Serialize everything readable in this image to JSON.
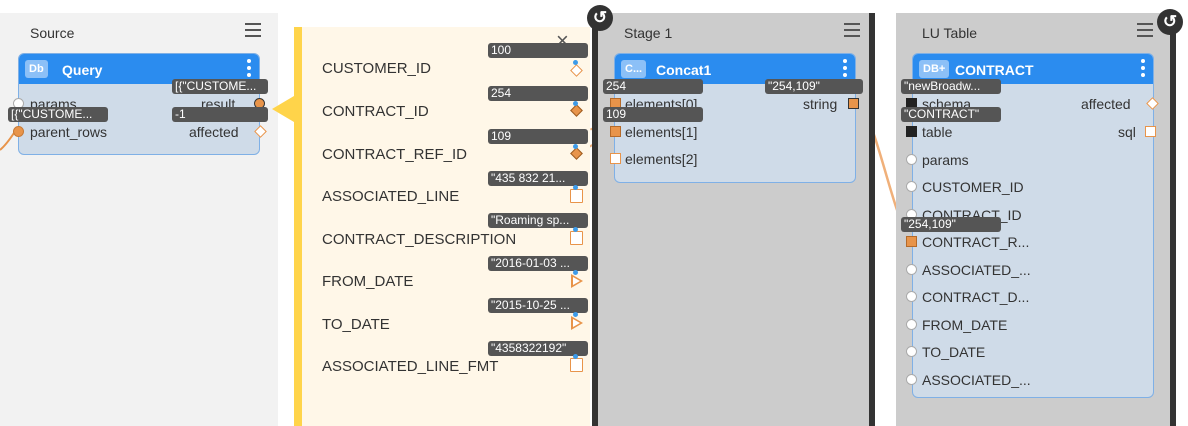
{
  "source": {
    "title": "Source",
    "node": {
      "badge": "Db",
      "label": "Query",
      "ports": {
        "params": "params",
        "result": "result",
        "parent_rows": "parent_rows",
        "affected": "affected"
      },
      "tags": {
        "result": "[{\"CUSTOME...",
        "parent_rows": "[{\"CUSTOME...",
        "affected": "-1"
      }
    }
  },
  "fields": {
    "items": [
      {
        "label": "CUSTOMER_ID",
        "value": "100"
      },
      {
        "label": "CONTRACT_ID",
        "value": "254"
      },
      {
        "label": "CONTRACT_REF_ID",
        "value": "109"
      },
      {
        "label": "ASSOCIATED_LINE",
        "value": "\"435 832 21..."
      },
      {
        "label": "CONTRACT_DESCRIPTION",
        "value": "\"Roaming sp..."
      },
      {
        "label": "FROM_DATE",
        "value": "\"2016-01-03 ..."
      },
      {
        "label": "TO_DATE",
        "value": "\"2015-10-25 ..."
      },
      {
        "label": "ASSOCIATED_LINE_FMT",
        "value": "\"4358322192\""
      }
    ],
    "close_glyph": "×"
  },
  "stage": {
    "title": "Stage 1",
    "node": {
      "badge": "C...",
      "label": "Concat1",
      "ports": {
        "e0": "elements[0]",
        "e1": "elements[1]",
        "e2": "elements[2]",
        "string": "string"
      },
      "tags": {
        "e0": "254",
        "e1": "109",
        "string": "\"254,109\""
      }
    }
  },
  "lu": {
    "title": "LU Table",
    "node": {
      "badge": "DB+",
      "label": "CONTRACT",
      "ports": {
        "schema": "schema",
        "affected": "affected",
        "table": "table",
        "sql": "sql",
        "params": "params",
        "customer_id": "CUSTOMER_ID",
        "contract_id": "CONTRACT_ID",
        "contract_r": "CONTRACT_R...",
        "associated": "ASSOCIATED_...",
        "contract_d": "CONTRACT_D...",
        "from_date": "FROM_DATE",
        "to_date": "TO_DATE",
        "associated2": "ASSOCIATED_..."
      },
      "tags": {
        "schema": "\"newBroadw...",
        "table": "\"CONTRACT\"",
        "contract_r": "\"254,109\""
      }
    }
  },
  "undo_glyph": "↺",
  "colors": {
    "accent": "#2b8cef",
    "port": "#e8944a",
    "yellow_bar": "#ffd44a",
    "panel_bg": "#f2f2f2",
    "stage_bg": "#cccccc"
  }
}
